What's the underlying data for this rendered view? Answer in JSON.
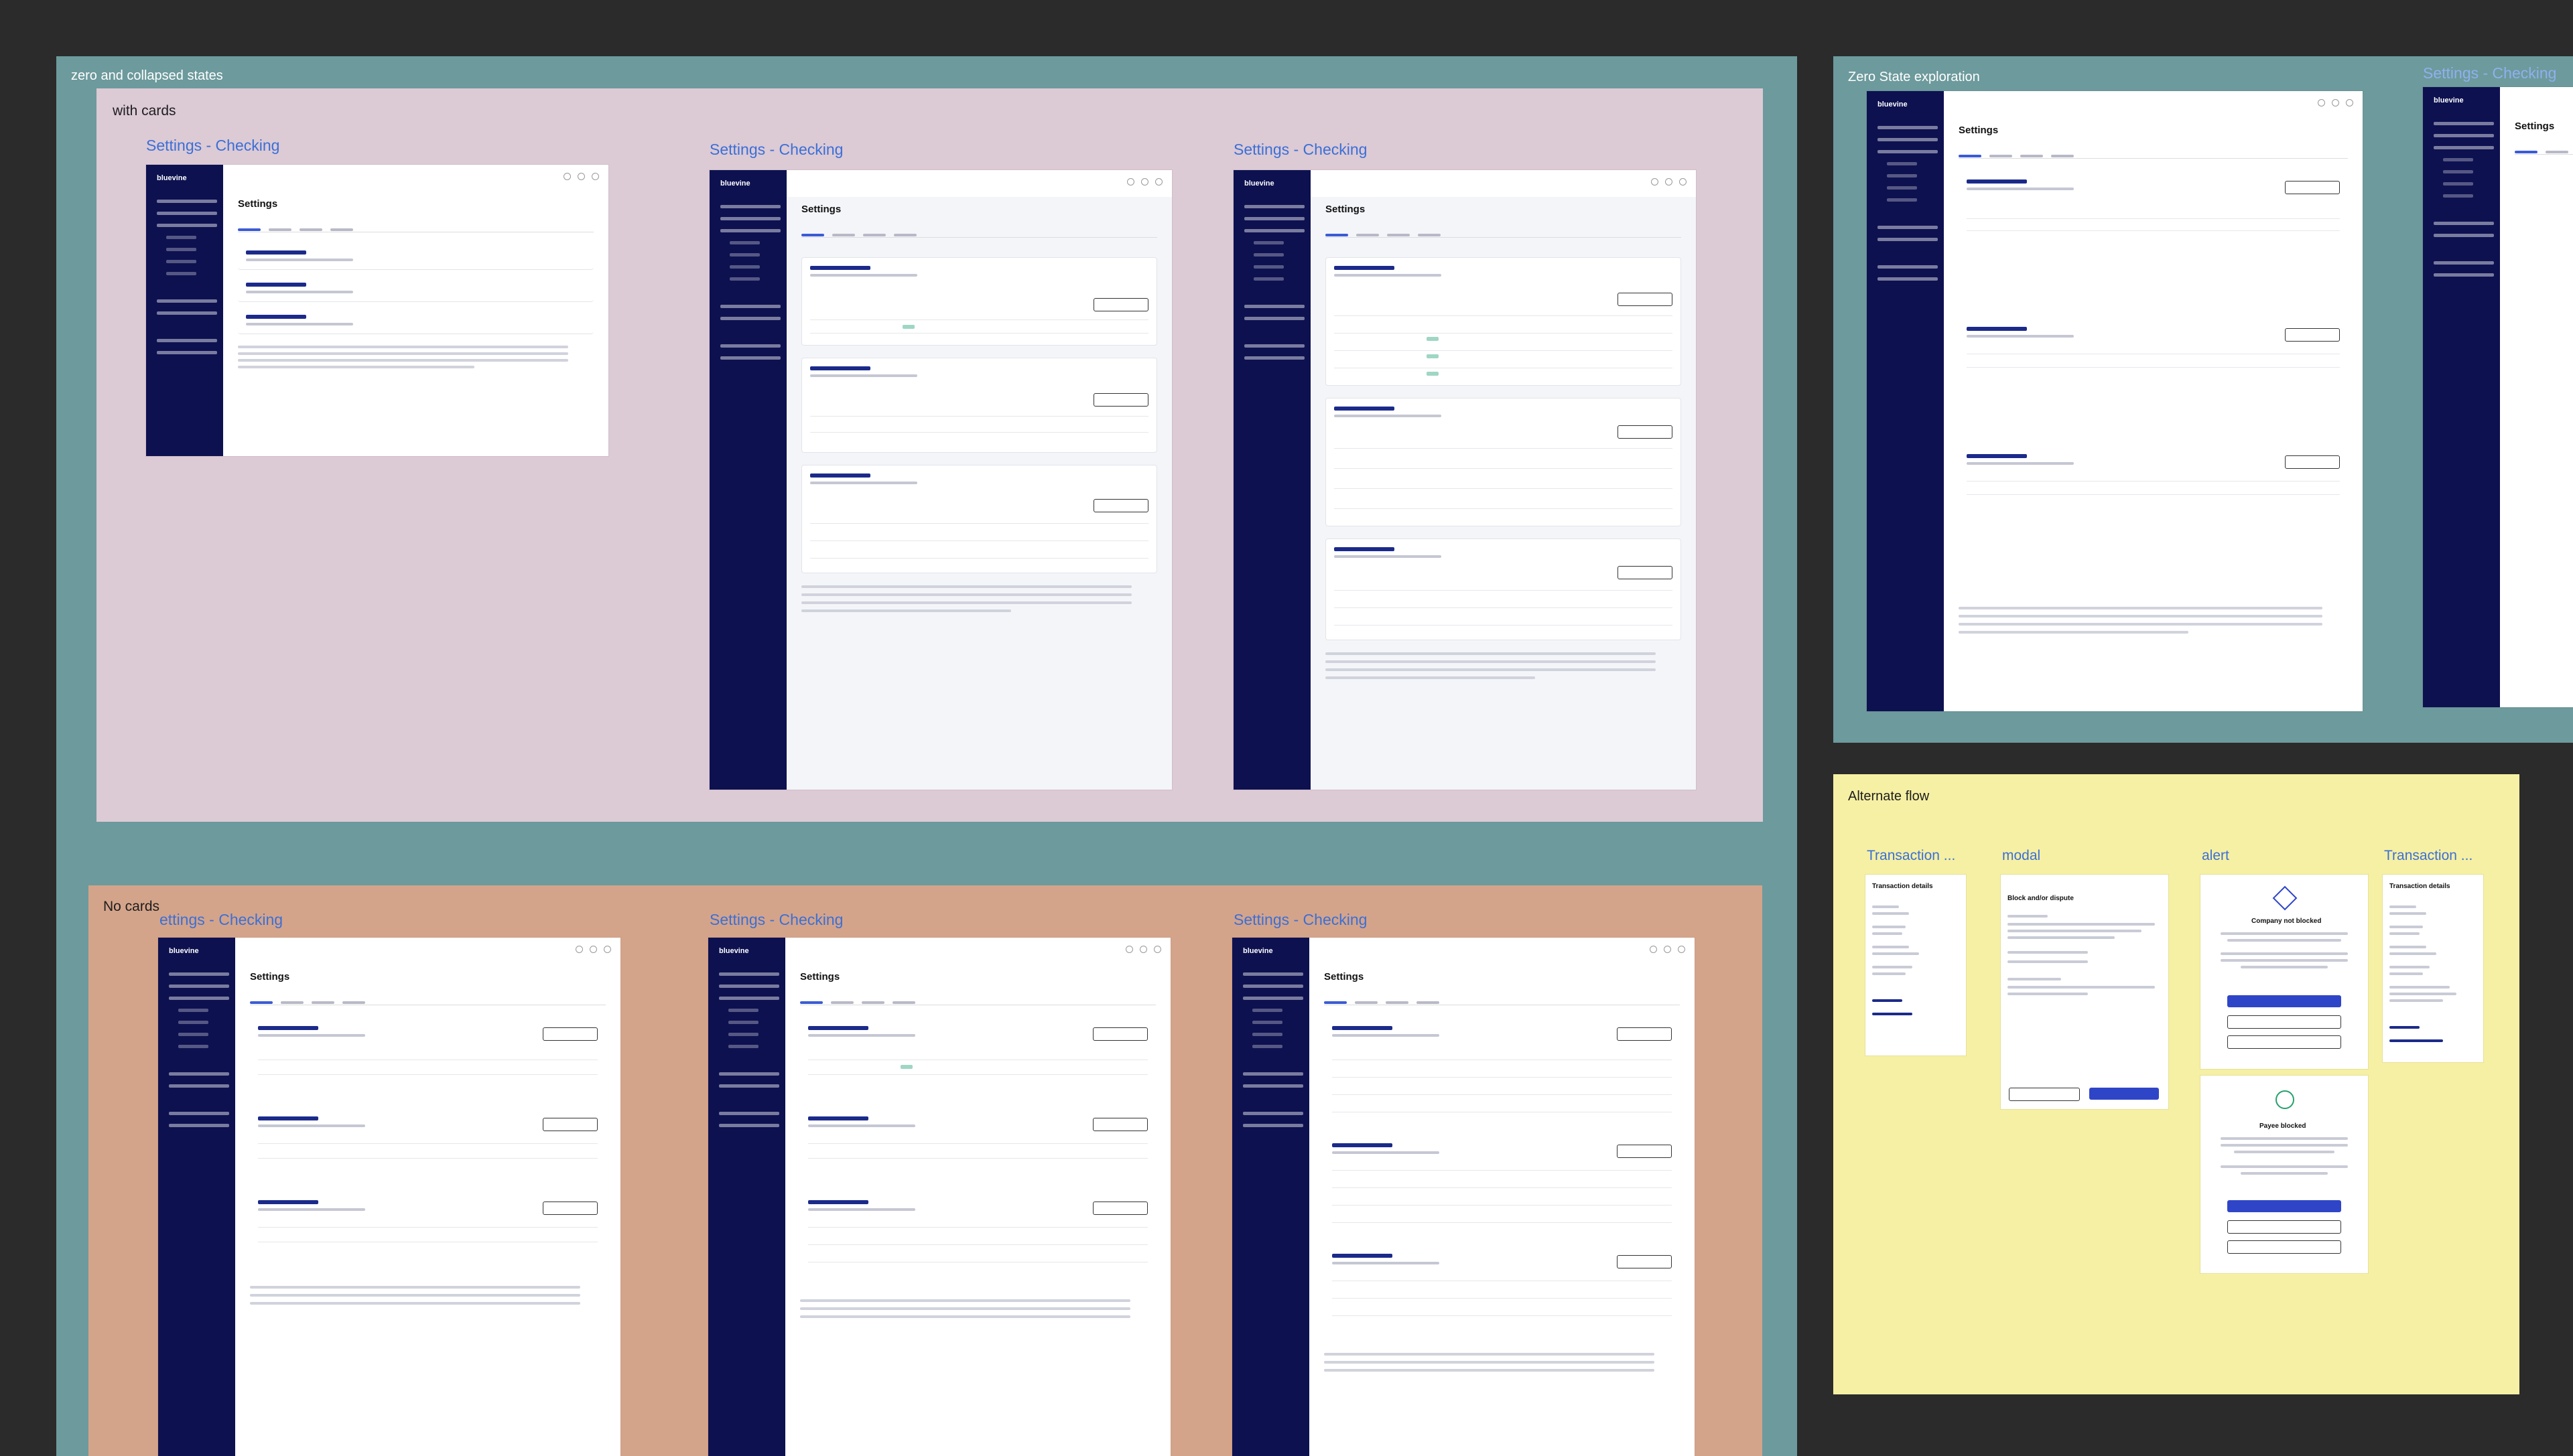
{
  "sections": {
    "zero_collapsed": "zero and collapsed states",
    "with_cards": "with cards",
    "no_cards": "No cards",
    "zero_state": "Zero State exploration",
    "alternate_flow": "Alternate flow"
  },
  "frame_titles": {
    "settings_checking": "Settings - Checking",
    "settings_checking_cut": "ettings - Checking",
    "transaction": "Transaction ...",
    "modal": "modal",
    "alert": "alert"
  },
  "app": {
    "brand": "bluevine",
    "page_title": "Settings"
  },
  "mini": {
    "transaction_details": "Transaction details",
    "block_dispute": "Block and/or dispute",
    "company_not_blocked": "Company not blocked",
    "payee_blocked": "Payee blocked"
  },
  "colors": {
    "teal_bg": "#6d9a9c",
    "pink_bg": "#dccad5",
    "peach_bg": "#d4a48a",
    "yellow_bg": "#f6f0a4",
    "sidebar": "#0d1150",
    "accent": "#3b5bd6"
  }
}
